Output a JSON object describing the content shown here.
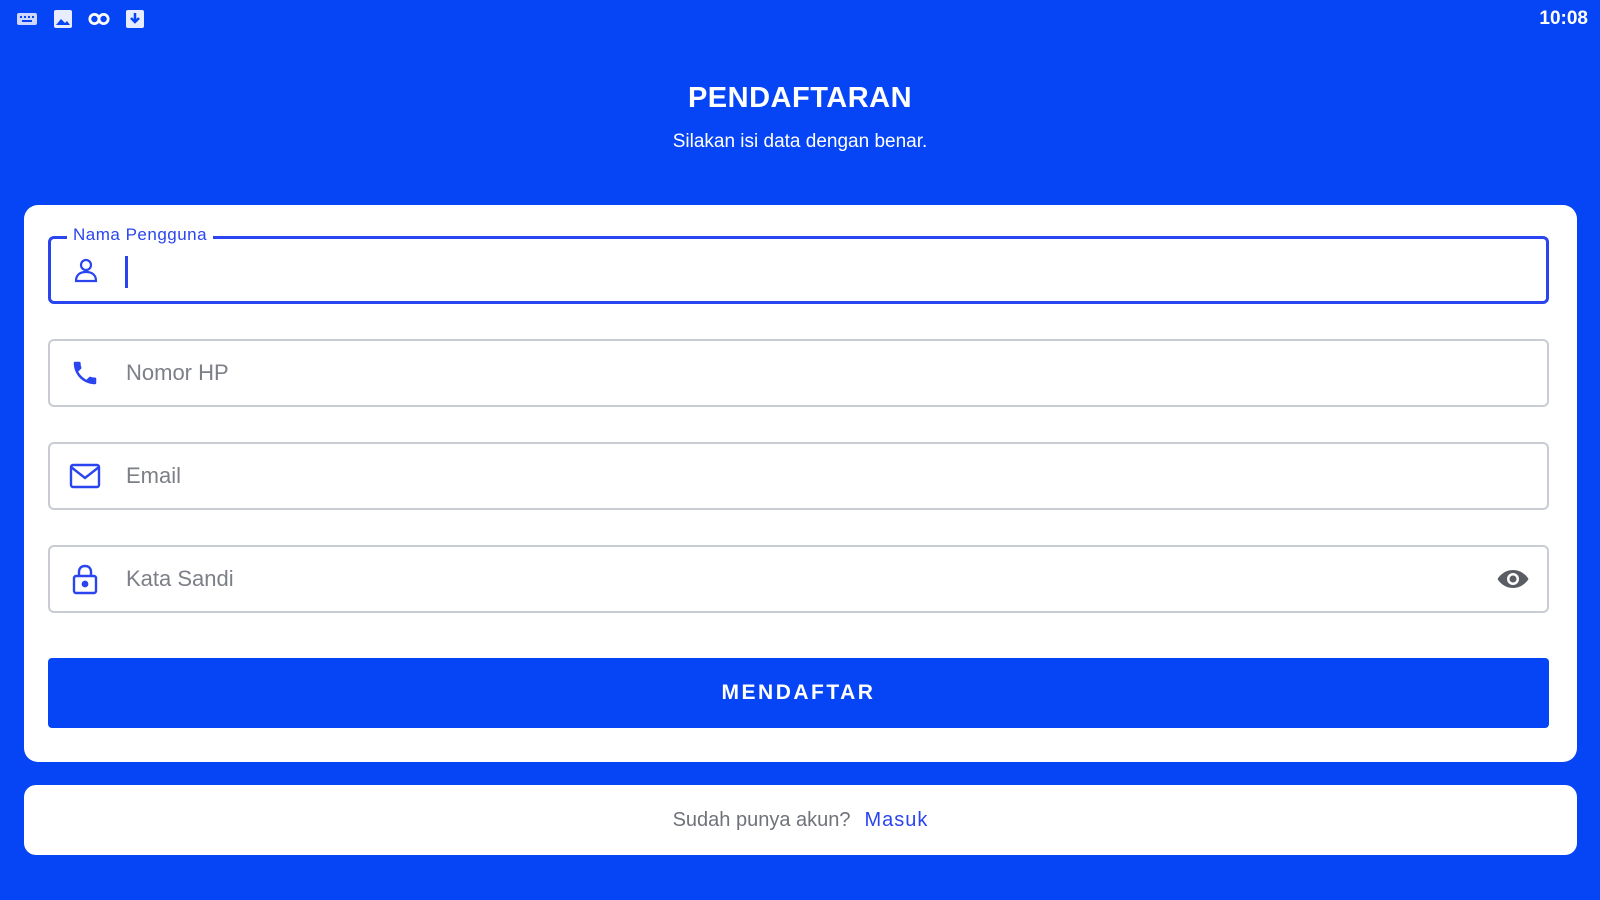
{
  "status_bar": {
    "time": "10:08",
    "icons": [
      "keyboard-icon",
      "image-icon",
      "link-icon",
      "download-icon"
    ]
  },
  "header": {
    "title": "PENDAFTARAN",
    "subtitle": "Silakan isi data dengan benar."
  },
  "form": {
    "username": {
      "label": "Nama Pengguna",
      "value": "",
      "icon": "person-icon"
    },
    "phone": {
      "placeholder": "Nomor HP",
      "icon": "phone-icon"
    },
    "email": {
      "placeholder": "Email",
      "icon": "mail-icon"
    },
    "password": {
      "placeholder": "Kata Sandi",
      "icon": "lock-icon",
      "toggle_icon": "eye-icon"
    },
    "submit_label": "MENDAFTAR"
  },
  "footer": {
    "text": "Sudah punya akun?",
    "link": "Masuk"
  },
  "colors": {
    "background": "#0645f5",
    "accent": "#2a45f0",
    "card": "#ffffff"
  }
}
